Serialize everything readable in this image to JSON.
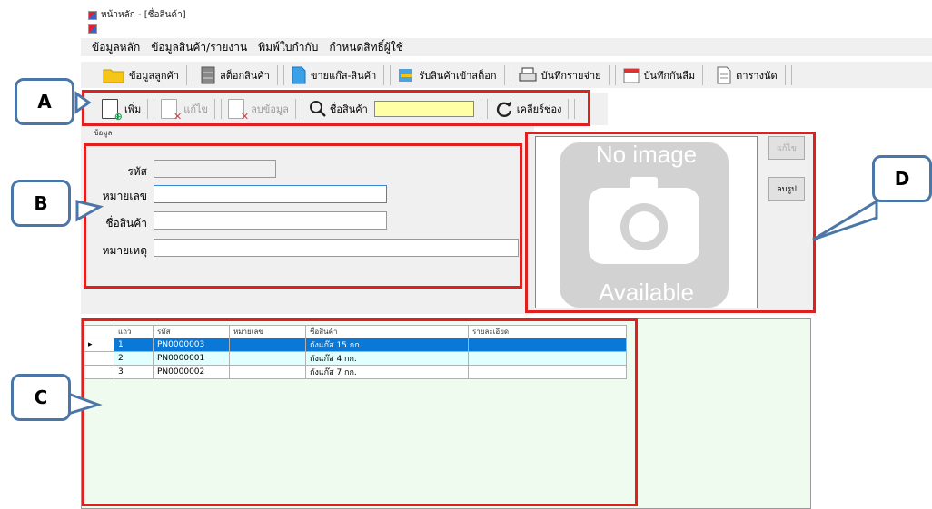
{
  "window": {
    "title": "หน้าหลัก - [ชื่อสินค้า]"
  },
  "menu": [
    "ข้อมูลหลัก",
    "ข้อมูลสินค้า/รายงาน",
    "พิมพ์ใบกำกับ",
    "กำหนดสิทธิ์ผู้ใช้"
  ],
  "toolbar1": [
    {
      "label": "ข้อมูลลูกค้า",
      "icon": "folder-icon"
    },
    {
      "label": "สต็อกสินค้า",
      "icon": "cabinet-icon"
    },
    {
      "label": "ขายแก๊ส-สินค้า",
      "icon": "document-icon"
    },
    {
      "label": "รับสินค้าเข้าสต็อก",
      "icon": "stack-icon"
    },
    {
      "label": "บันทึกรายจ่าย",
      "icon": "printer-icon"
    },
    {
      "label": "บันทึกกันลืม",
      "icon": "calendar-icon"
    },
    {
      "label": "ตารางนัด",
      "icon": "note-icon"
    }
  ],
  "toolbar2": {
    "add": "เพิ่ม",
    "edit": "แก้ไข",
    "delete": "ลบข้อมูล",
    "search_label": "ชื่อสินค้า",
    "search_value": "",
    "clear": "เคลียร์ช่อง"
  },
  "form": {
    "group_label": "ข้อมูล",
    "code_label": "รหัส",
    "code_value": "",
    "number_label": "หมายเลข",
    "number_value": "",
    "name_label": "ชื่อสินค้า",
    "name_value": "",
    "note_label": "หมายเหตุ",
    "note_value": ""
  },
  "photo": {
    "line1": "No image",
    "line2": "Available",
    "edit_btn": "แก้ไข",
    "delete_btn": "ลบรูป"
  },
  "grid": {
    "columns": [
      "แถว",
      "รหัส",
      "หมายเลข",
      "ชื่อสินค้า",
      "รายละเอียด"
    ],
    "rows": [
      {
        "row": "1",
        "code": "PN0000003",
        "number": "",
        "name": "ถังแก๊ส 15 กก.",
        "detail": ""
      },
      {
        "row": "2",
        "code": "PN0000001",
        "number": "",
        "name": "ถังแก๊ส 4 กก.",
        "detail": ""
      },
      {
        "row": "3",
        "code": "PN0000002",
        "number": "",
        "name": "ถังแก๊ส 7 กก.",
        "detail": ""
      }
    ]
  },
  "callouts": {
    "a": "A",
    "b": "B",
    "c": "C",
    "d": "D"
  },
  "colors": {
    "highlight": "#e0201e",
    "callout_border": "#4a76a8",
    "selected_row": "#0a78d7",
    "search_bg": "#ffffa6"
  }
}
